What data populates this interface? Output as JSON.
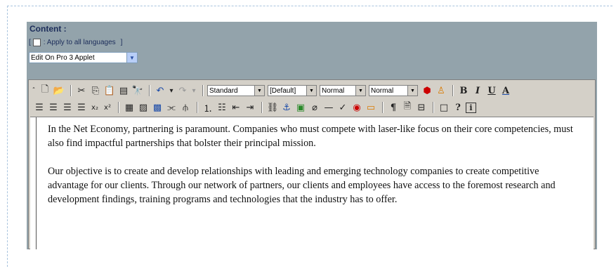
{
  "field": {
    "label": "Content :",
    "bracket_open": "[",
    "apply_all_languages": ": Apply to all languages",
    "bracket_close": "]"
  },
  "applet": {
    "selected": "Edit On Pro 3 Applet"
  },
  "toolbar": {
    "style_select": "Standard",
    "font_select": "[Default]",
    "size_select": "Normal",
    "format_select": "Normal",
    "bold": "B",
    "italic": "I",
    "underline": "U",
    "font_color": "A",
    "subscript": "x₂",
    "superscript": "x²",
    "paragraph": "¶",
    "help": "?",
    "info": "i"
  },
  "document": {
    "paragraphs": [
      "In the Net Economy, partnering is paramount. Companies who must compete with laser-like focus on their core competencies, must also find impactful partnerships that bolster their principal mission.",
      "Our objective is to create and develop relationships with leading and emerging technology companies to create competitive advantage for our clients. Through our network of partners, our clients and employees have access to the foremost research and development findings, training programs and technologies that the industry has to offer."
    ]
  }
}
